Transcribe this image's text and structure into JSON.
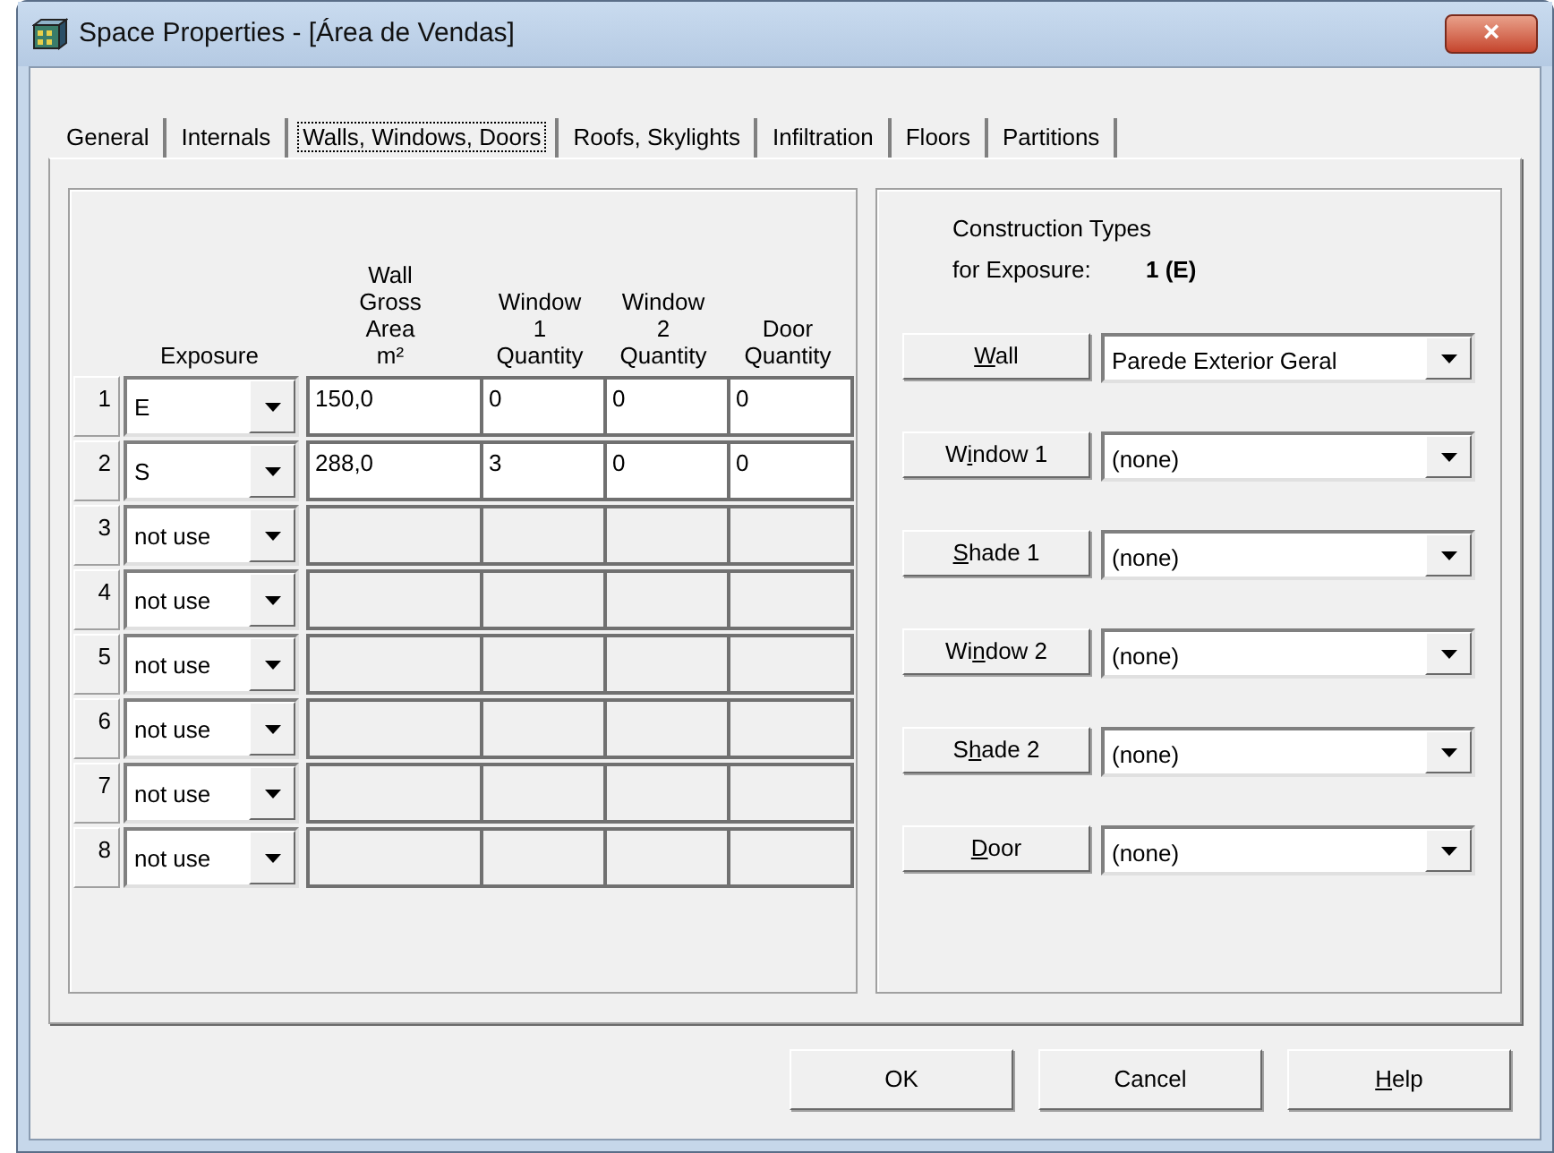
{
  "window": {
    "title": "Space Properties - [Área de Vendas]",
    "close": "×"
  },
  "tabs": [
    {
      "label": "General",
      "selected": false
    },
    {
      "label": "Internals",
      "selected": false
    },
    {
      "label": "Walls, Windows, Doors",
      "selected": true
    },
    {
      "label": "Roofs, Skylights",
      "selected": false
    },
    {
      "label": "Infiltration",
      "selected": false
    },
    {
      "label": "Floors",
      "selected": false
    },
    {
      "label": "Partitions",
      "selected": false
    }
  ],
  "table": {
    "columns": [
      {
        "lines": [
          "Exposure"
        ]
      },
      {
        "lines": [
          "Wall",
          "Gross",
          "Area",
          "m²"
        ]
      },
      {
        "lines": [
          "Window",
          "1",
          "Quantity"
        ]
      },
      {
        "lines": [
          "Window",
          "2",
          "Quantity"
        ]
      },
      {
        "lines": [
          "Door",
          "Quantity"
        ]
      }
    ],
    "rows": [
      {
        "number": "1",
        "exposure": "E",
        "disabled": false,
        "cells": [
          "150,0",
          "0",
          "0",
          "0"
        ]
      },
      {
        "number": "2",
        "exposure": "S",
        "disabled": false,
        "cells": [
          "288,0",
          "3",
          "0",
          "0"
        ]
      },
      {
        "number": "3",
        "exposure": "not use",
        "disabled": true
      },
      {
        "number": "4",
        "exposure": "not use",
        "disabled": true
      },
      {
        "number": "5",
        "exposure": "not use",
        "disabled": true
      },
      {
        "number": "6",
        "exposure": "not use",
        "disabled": true
      },
      {
        "number": "7",
        "exposure": "not use",
        "disabled": true
      },
      {
        "number": "8",
        "exposure": "not use",
        "disabled": true
      }
    ]
  },
  "construction": {
    "heading": "Construction Types",
    "exposure_label": "for Exposure:",
    "exposure_value": "1 (E)",
    "rows": [
      {
        "button": {
          "key": "W",
          "after": "all"
        },
        "value": "Parede Exterior Geral"
      },
      {
        "button": {
          "before": "W",
          "key": "i",
          "after": "ndow 1"
        },
        "value": "(none)"
      },
      {
        "button": {
          "key": "S",
          "after": "hade 1"
        },
        "value": "(none)"
      },
      {
        "button": {
          "before": "Wi",
          "key": "n",
          "after": "dow 2"
        },
        "value": "(none)"
      },
      {
        "button": {
          "before": "S",
          "key": "h",
          "after": "ade 2"
        },
        "value": "(none)"
      },
      {
        "button": {
          "key": "D",
          "after": "oor"
        },
        "value": "(none)"
      }
    ]
  },
  "buttons": [
    {
      "after": "OK"
    },
    {
      "after": "Cancel"
    },
    {
      "key": "H",
      "after": "elp"
    }
  ]
}
